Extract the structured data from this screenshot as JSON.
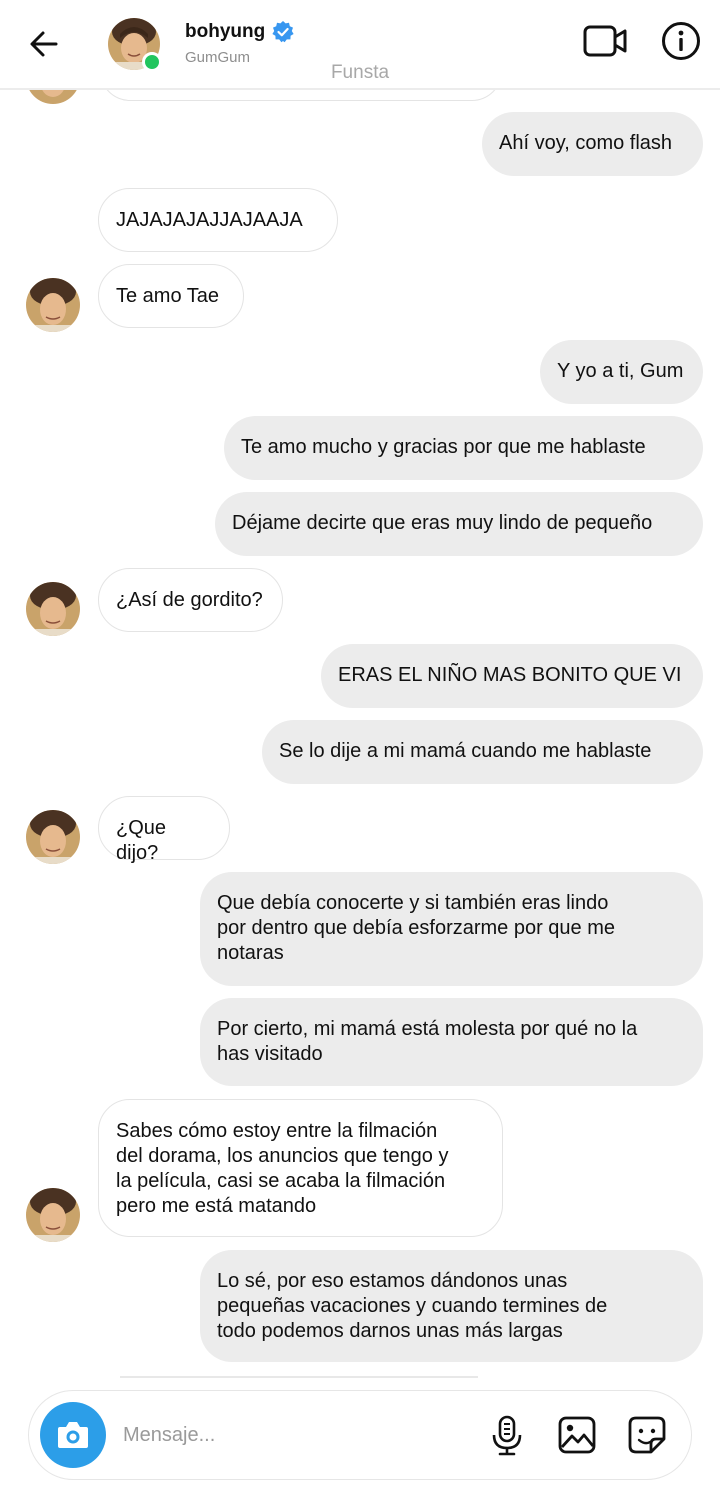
{
  "header": {
    "username": "bohyung",
    "subname": "GumGum",
    "watermark": "Funsta"
  },
  "messages": [
    {
      "side": "out",
      "text": "Ahí voy, como flash"
    },
    {
      "side": "in",
      "text": "JAJAJAJAJJAJAAJA"
    },
    {
      "side": "in",
      "text": "Te amo Tae"
    },
    {
      "side": "out",
      "text": "Y yo a ti, Gum"
    },
    {
      "side": "out",
      "text": "Te amo mucho y gracias por que me hablaste"
    },
    {
      "side": "out",
      "text": "Déjame decirte que eras muy lindo de pequeño"
    },
    {
      "side": "in",
      "text": "¿Así de gordito?"
    },
    {
      "side": "out",
      "text": "ERAS EL NIÑO MAS BONITO QUE VI"
    },
    {
      "side": "out",
      "text": "Se lo dije a mi mamá cuando me hablaste"
    },
    {
      "side": "in",
      "text": "¿Que dijo?"
    },
    {
      "side": "out",
      "text": "Que debía conocerte y si también eras lindo\npor dentro que debía esforzarme por que me\nnotaras"
    },
    {
      "side": "out",
      "text": "Por cierto, mi mamá está molesta por qué no la\nhas visitado"
    },
    {
      "side": "in",
      "text": "Sabes cómo estoy entre la filmación\ndel dorama, los anuncios que tengo y\nla película, casi se acaba la filmación\npero me está matando"
    },
    {
      "side": "out",
      "text": "Lo sé, por eso estamos dándonos unas\npequeñas vacaciones y cuando termines de\ntodo podemos darnos unas más largas"
    }
  ],
  "composer": {
    "placeholder": "Mensaje..."
  },
  "colors": {
    "accent": "#2c9ee8",
    "verified": "#3897f0",
    "online": "#22c55e",
    "incoming_bubble": "#ffffff",
    "outgoing_bubble": "#ececec"
  }
}
